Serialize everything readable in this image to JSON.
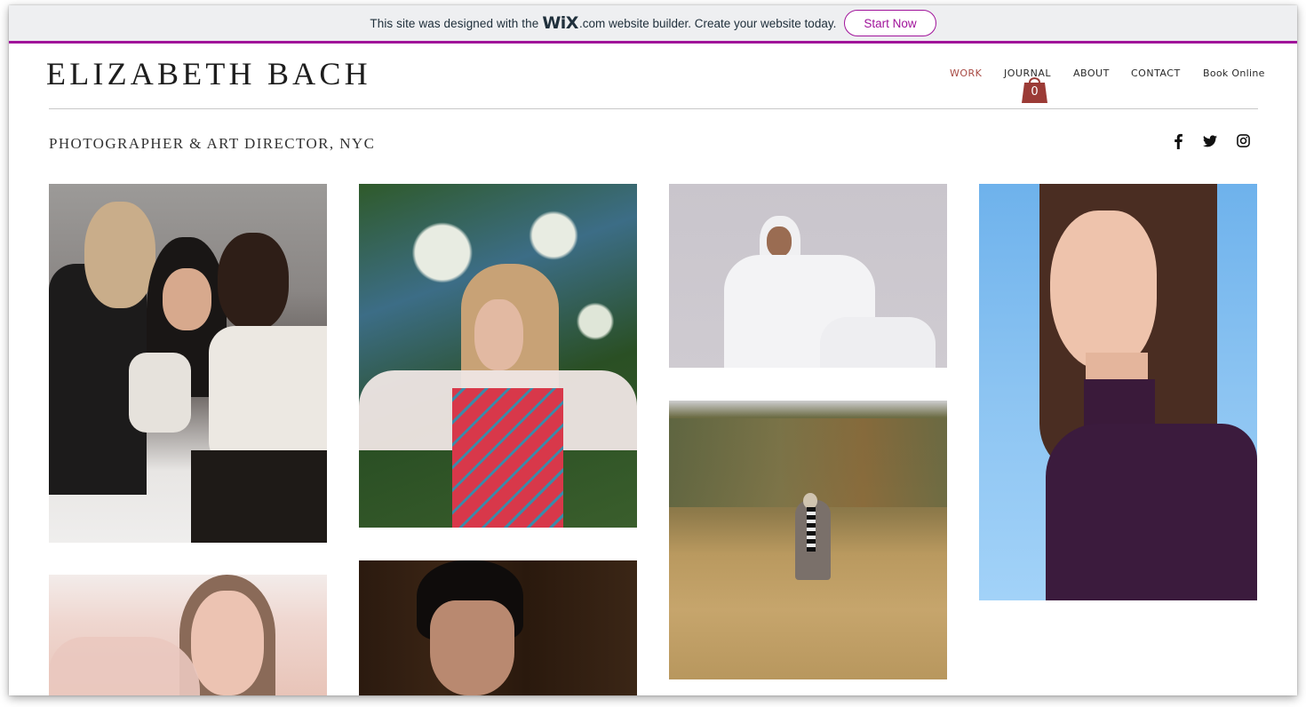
{
  "banner": {
    "text_before": "This site was designed with the",
    "logo": "WiX",
    "text_after": ".com website builder. Create your website today.",
    "cta_label": "Start Now",
    "accent_color": "#a0139a"
  },
  "header": {
    "site_title": "ELIZABETH BACH",
    "tagline": "PHOTOGRAPHER & ART DIRECTOR, NYC"
  },
  "nav": {
    "items": [
      {
        "label": "WORK",
        "active": true
      },
      {
        "label": "JOURNAL",
        "active": false
      },
      {
        "label": "ABOUT",
        "active": false
      },
      {
        "label": "CONTACT",
        "active": false
      },
      {
        "label": "Book Online",
        "active": false
      }
    ],
    "active_color": "#a84a44"
  },
  "cart": {
    "count": "0",
    "icon": "shopping-bag-icon",
    "color": "#9b3b36"
  },
  "social": [
    {
      "name": "facebook",
      "icon": "facebook-icon"
    },
    {
      "name": "twitter",
      "icon": "twitter-icon"
    },
    {
      "name": "instagram",
      "icon": "instagram-icon"
    }
  ],
  "gallery": {
    "items": [
      {
        "description": "Three models posing together in black and white knitwear"
      },
      {
        "description": "Model with long hair among white blossoms wearing red and blue knit vest"
      },
      {
        "description": "Model in white hijab and white outfit seated on grey backdrop"
      },
      {
        "description": "Figure standing in tall golden grass field before autumn trees"
      },
      {
        "description": "Profile of model with long brown hair in purple turtleneck on blue backdrop"
      },
      {
        "description": "Model framed by pale pink feathers"
      },
      {
        "description": "Man with slicked back dark hair against wood background"
      }
    ]
  }
}
